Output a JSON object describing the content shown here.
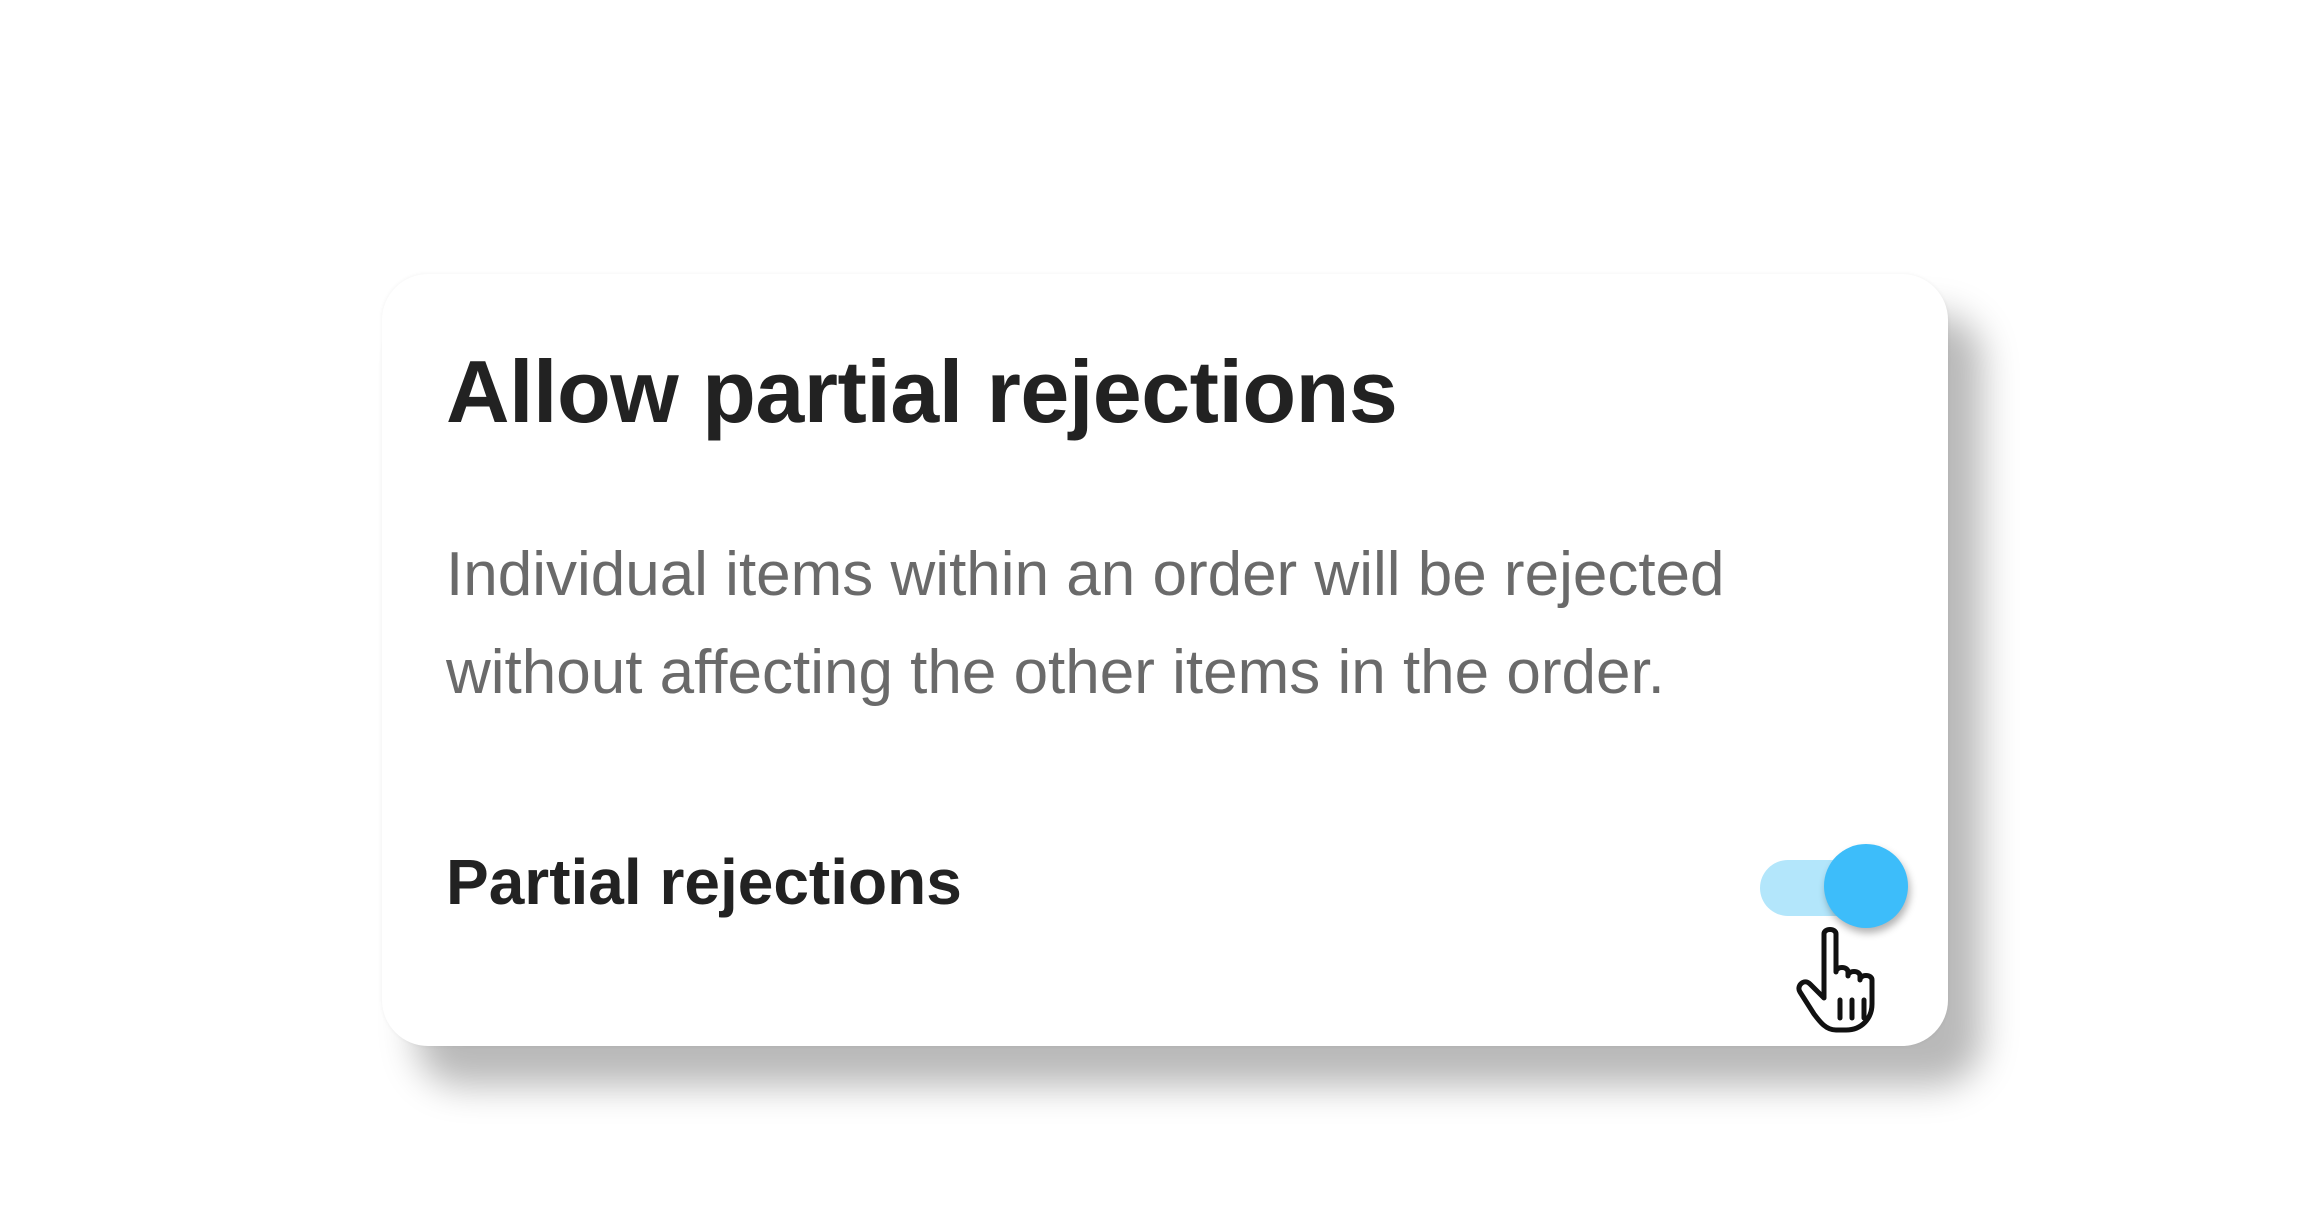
{
  "card": {
    "title": "Allow partial rejections",
    "description": "Individual items within an order will be rejected without affecting the other items in the order."
  },
  "setting": {
    "label": "Partial rejections",
    "toggle_state": "on",
    "track_color": "#b3e6fb",
    "thumb_color": "#3dbdfa"
  },
  "pointer": {
    "icon": "hand-pointer-icon"
  }
}
